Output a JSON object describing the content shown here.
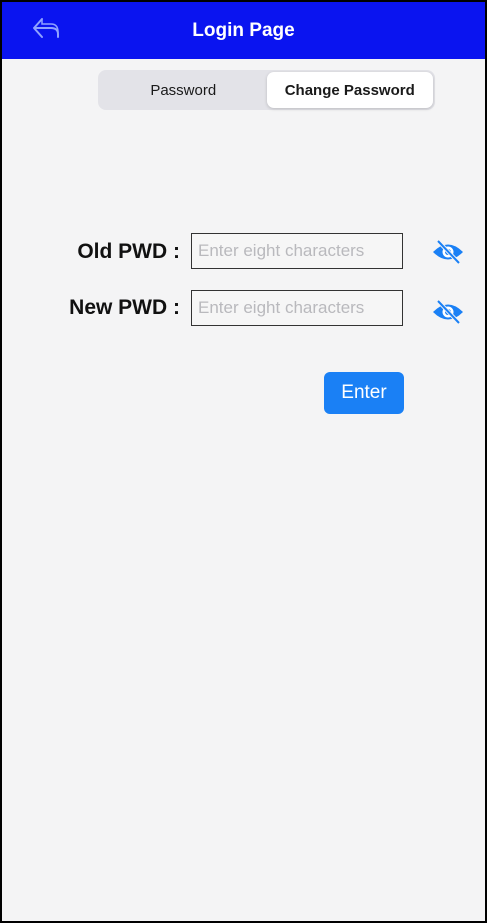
{
  "header": {
    "title": "Login Page",
    "back_icon": "back-arrow-icon"
  },
  "tabs": [
    {
      "label": "Password",
      "selected": false
    },
    {
      "label": "Change Password",
      "selected": true
    }
  ],
  "form": {
    "old_pwd": {
      "label": "Old PWD :",
      "value": "",
      "placeholder": "Enter eight characters",
      "visibility_icon": "eye-slash-icon"
    },
    "new_pwd": {
      "label": "New PWD :",
      "value": "",
      "placeholder": "Enter eight characters",
      "visibility_icon": "eye-slash-icon"
    },
    "submit_label": "Enter"
  },
  "colors": {
    "navbar": "#0a14f0",
    "accent": "#1a80f5",
    "background": "#f4f4f5"
  }
}
